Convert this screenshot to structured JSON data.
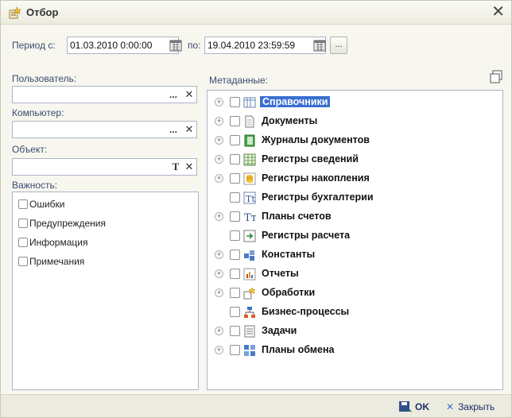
{
  "window": {
    "title": "Отбор",
    "close_glyph": "✕"
  },
  "period": {
    "from_label": "Период с:",
    "from_value": "01.03.2010  0:00:00",
    "to_label": "по:",
    "to_value": "19.04.2010 23:59:59",
    "more_button": "..."
  },
  "filters": {
    "user_label": "Пользователь:",
    "computer_label": "Компьютер:",
    "object_label": "Объект:",
    "importance_label": "Важность:",
    "choose_glyph": "...",
    "clear_glyph": "✕",
    "type_glyph": "T"
  },
  "importance": [
    {
      "label": "Ошибки",
      "checked": false
    },
    {
      "label": "Предупреждения",
      "checked": false
    },
    {
      "label": "Информация",
      "checked": false
    },
    {
      "label": "Примечания",
      "checked": false
    }
  ],
  "metadata": {
    "label": "Метаданные:",
    "items": [
      {
        "label": "Справочники",
        "icon": "catalogs-icon",
        "expandable": true,
        "selected": true
      },
      {
        "label": "Документы",
        "icon": "documents-icon",
        "expandable": true,
        "selected": false
      },
      {
        "label": "Журналы документов",
        "icon": "document-journals-icon",
        "expandable": true,
        "selected": false
      },
      {
        "label": "Регистры сведений",
        "icon": "information-registers-icon",
        "expandable": true,
        "selected": false
      },
      {
        "label": "Регистры накопления",
        "icon": "accumulation-registers-icon",
        "expandable": true,
        "selected": false
      },
      {
        "label": "Регистры бухгалтерии",
        "icon": "accounting-registers-icon",
        "expandable": false,
        "selected": false
      },
      {
        "label": "Планы счетов",
        "icon": "charts-of-accounts-icon",
        "expandable": true,
        "selected": false
      },
      {
        "label": "Регистры расчета",
        "icon": "calculation-registers-icon",
        "expandable": false,
        "selected": false
      },
      {
        "label": "Константы",
        "icon": "constants-icon",
        "expandable": true,
        "selected": false
      },
      {
        "label": "Отчеты",
        "icon": "reports-icon",
        "expandable": true,
        "selected": false
      },
      {
        "label": "Обработки",
        "icon": "data-processors-icon",
        "expandable": true,
        "selected": false
      },
      {
        "label": "Бизнес-процессы",
        "icon": "business-processes-icon",
        "expandable": false,
        "selected": false
      },
      {
        "label": "Задачи",
        "icon": "tasks-icon",
        "expandable": true,
        "selected": false
      },
      {
        "label": "Планы обмена",
        "icon": "exchange-plans-icon",
        "expandable": true,
        "selected": false
      }
    ]
  },
  "footer": {
    "ok_label": "OK",
    "close_label": "Закрыть"
  },
  "colors": {
    "selection": "#3a6fd0",
    "label_text": "#3a4a6e",
    "button_text": "#1a2f6b"
  }
}
